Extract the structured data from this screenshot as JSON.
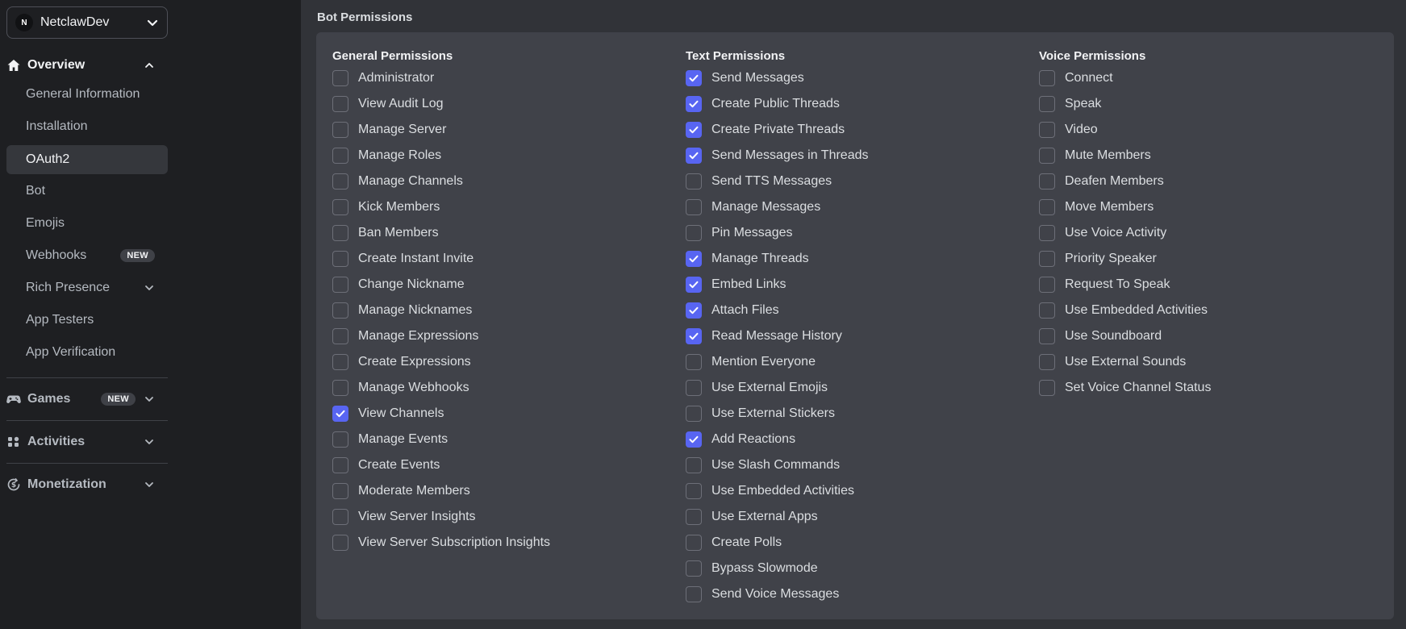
{
  "sidebar": {
    "app_initial": "N",
    "app_name": "NetclawDev",
    "overview": {
      "label": "Overview",
      "items": [
        {
          "label": "General Information"
        },
        {
          "label": "Installation"
        },
        {
          "label": "OAuth2",
          "selected": true
        },
        {
          "label": "Bot"
        },
        {
          "label": "Emojis"
        },
        {
          "label": "Webhooks",
          "badge": "NEW"
        },
        {
          "label": "Rich Presence"
        },
        {
          "label": "App Testers"
        },
        {
          "label": "App Verification"
        }
      ]
    },
    "games": {
      "label": "Games",
      "badge": "NEW"
    },
    "activities": {
      "label": "Activities"
    },
    "monetization": {
      "label": "Monetization"
    }
  },
  "main": {
    "section_title": "Bot Permissions",
    "columns": [
      {
        "title": "General Permissions",
        "permissions": [
          {
            "label": "Administrator",
            "checked": false
          },
          {
            "label": "View Audit Log",
            "checked": false
          },
          {
            "label": "Manage Server",
            "checked": false
          },
          {
            "label": "Manage Roles",
            "checked": false
          },
          {
            "label": "Manage Channels",
            "checked": false
          },
          {
            "label": "Kick Members",
            "checked": false
          },
          {
            "label": "Ban Members",
            "checked": false
          },
          {
            "label": "Create Instant Invite",
            "checked": false
          },
          {
            "label": "Change Nickname",
            "checked": false
          },
          {
            "label": "Manage Nicknames",
            "checked": false
          },
          {
            "label": "Manage Expressions",
            "checked": false
          },
          {
            "label": "Create Expressions",
            "checked": false
          },
          {
            "label": "Manage Webhooks",
            "checked": false
          },
          {
            "label": "View Channels",
            "checked": true
          },
          {
            "label": "Manage Events",
            "checked": false
          },
          {
            "label": "Create Events",
            "checked": false
          },
          {
            "label": "Moderate Members",
            "checked": false
          },
          {
            "label": "View Server Insights",
            "checked": false
          },
          {
            "label": "View Server Subscription Insights",
            "checked": false
          }
        ]
      },
      {
        "title": "Text Permissions",
        "permissions": [
          {
            "label": "Send Messages",
            "checked": true
          },
          {
            "label": "Create Public Threads",
            "checked": true
          },
          {
            "label": "Create Private Threads",
            "checked": true
          },
          {
            "label": "Send Messages in Threads",
            "checked": true
          },
          {
            "label": "Send TTS Messages",
            "checked": false
          },
          {
            "label": "Manage Messages",
            "checked": false
          },
          {
            "label": "Pin Messages",
            "checked": false
          },
          {
            "label": "Manage Threads",
            "checked": true
          },
          {
            "label": "Embed Links",
            "checked": true
          },
          {
            "label": "Attach Files",
            "checked": true
          },
          {
            "label": "Read Message History",
            "checked": true
          },
          {
            "label": "Mention Everyone",
            "checked": false
          },
          {
            "label": "Use External Emojis",
            "checked": false
          },
          {
            "label": "Use External Stickers",
            "checked": false
          },
          {
            "label": "Add Reactions",
            "checked": true
          },
          {
            "label": "Use Slash Commands",
            "checked": false
          },
          {
            "label": "Use Embedded Activities",
            "checked": false
          },
          {
            "label": "Use External Apps",
            "checked": false
          },
          {
            "label": "Create Polls",
            "checked": false
          },
          {
            "label": "Bypass Slowmode",
            "checked": false
          },
          {
            "label": "Send Voice Messages",
            "checked": false
          }
        ]
      },
      {
        "title": "Voice Permissions",
        "permissions": [
          {
            "label": "Connect",
            "checked": false
          },
          {
            "label": "Speak",
            "checked": false
          },
          {
            "label": "Video",
            "checked": false
          },
          {
            "label": "Mute Members",
            "checked": false
          },
          {
            "label": "Deafen Members",
            "checked": false
          },
          {
            "label": "Move Members",
            "checked": false
          },
          {
            "label": "Use Voice Activity",
            "checked": false
          },
          {
            "label": "Priority Speaker",
            "checked": false
          },
          {
            "label": "Request To Speak",
            "checked": false
          },
          {
            "label": "Use Embedded Activities",
            "checked": false
          },
          {
            "label": "Use Soundboard",
            "checked": false
          },
          {
            "label": "Use External Sounds",
            "checked": false
          },
          {
            "label": "Set Voice Channel Status",
            "checked": false
          }
        ]
      }
    ]
  },
  "colors": {
    "accent": "#5865f2",
    "sidebar_bg": "#1e1f22",
    "main_bg": "#313338",
    "panel_bg": "#404249"
  },
  "icons": [
    "chevron-down-icon",
    "home-icon",
    "chevron-up-icon",
    "gamepad-icon",
    "activities-icon",
    "monetization-icon",
    "checkmark-icon"
  ]
}
